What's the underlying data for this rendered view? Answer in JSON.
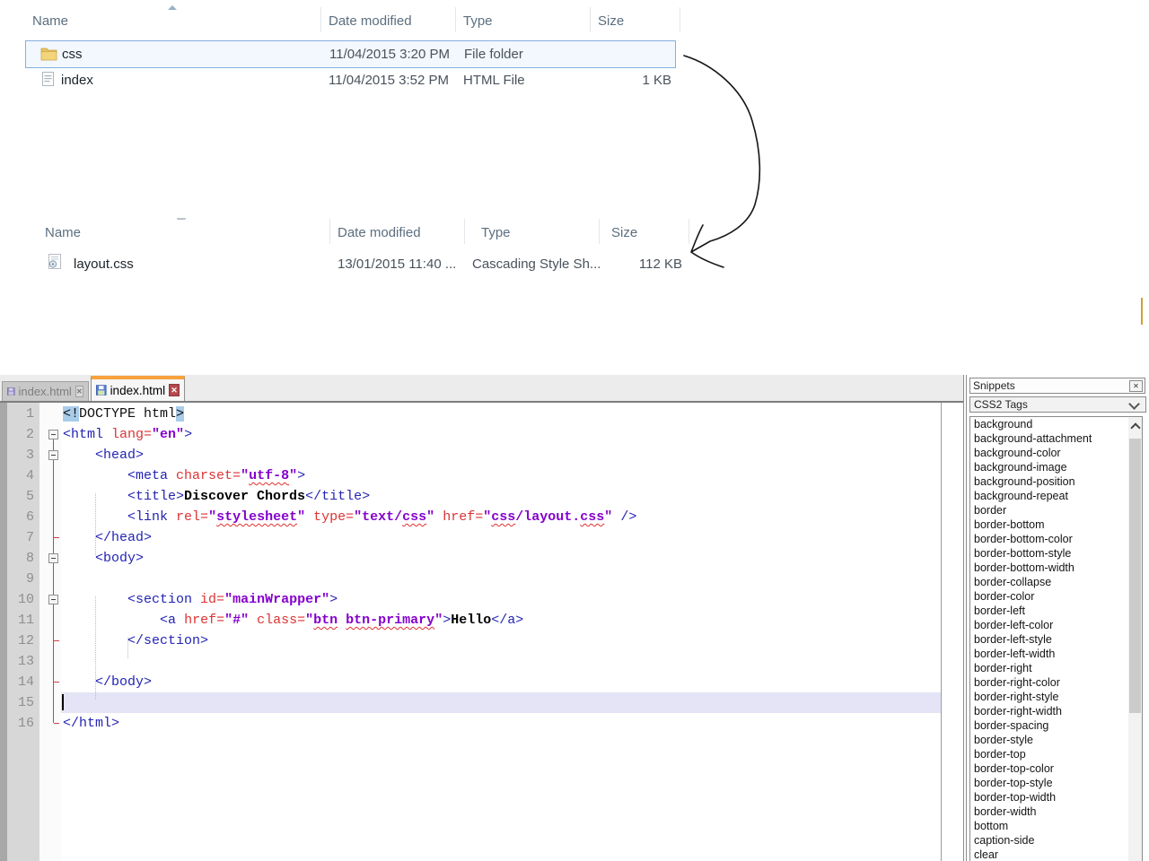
{
  "colors": {
    "accent_orange": "#f7a23c",
    "selection_blue_border": "#84b0e0",
    "fold_line_red": "#c94444",
    "tag_blue": "#2424b4",
    "attr_red": "#dc3434",
    "value_purple": "#8400cc",
    "current_line_bg": "#e4e4f6",
    "tag_match_highlight": "#a9cce9"
  },
  "explorer_top": {
    "columns": [
      "Name",
      "Date modified",
      "Type",
      "Size"
    ],
    "sort": "ascending",
    "rows": [
      {
        "name": "css",
        "date": "11/04/2015 3:20 PM",
        "type": "File folder",
        "size": "",
        "icon": "folder",
        "selected": true
      },
      {
        "name": "index",
        "date": "11/04/2015 3:52 PM",
        "type": "HTML File",
        "size": "1 KB",
        "icon": "html-file",
        "selected": false
      }
    ]
  },
  "explorer_bottom": {
    "columns": [
      "Name",
      "Date modified",
      "Type",
      "Size"
    ],
    "rows": [
      {
        "name": "layout.css",
        "date": "13/01/2015 11:40 ...",
        "type": "Cascading Style Sh...",
        "size": "112 KB",
        "icon": "css-file",
        "selected": false
      }
    ]
  },
  "editor": {
    "tabs": [
      {
        "label": "index.html",
        "active": false,
        "icon": "floppy-saved-icon",
        "close": "x"
      },
      {
        "label": "index.html",
        "active": true,
        "icon": "floppy-saved-icon",
        "close": "x"
      }
    ],
    "current_line": 15,
    "lines": [
      {
        "num": 1,
        "fold": null,
        "tokens": [
          [
            "hlm",
            "<!"
          ],
          [
            "pln",
            "DOCTYPE html"
          ],
          [
            "hlm",
            ">"
          ]
        ]
      },
      {
        "num": 2,
        "fold": "box",
        "tokens": [
          [
            "tag",
            "<html"
          ],
          [
            "pln",
            " "
          ],
          [
            "attr",
            "lang="
          ],
          [
            "val",
            "\"en\""
          ],
          [
            "tag",
            ">"
          ]
        ]
      },
      {
        "num": 3,
        "fold": "box",
        "tokens": [
          [
            "pln",
            "    "
          ],
          [
            "tag",
            "<head>"
          ]
        ]
      },
      {
        "num": 4,
        "fold": "line",
        "tokens": [
          [
            "pln",
            "        "
          ],
          [
            "tag",
            "<meta"
          ],
          [
            "pln",
            " "
          ],
          [
            "attr",
            "charset="
          ],
          [
            "val",
            "\""
          ],
          [
            "valw",
            "utf-8"
          ],
          [
            "val",
            "\""
          ],
          [
            "tag",
            ">"
          ]
        ]
      },
      {
        "num": 5,
        "fold": "line",
        "tokens": [
          [
            "pln",
            "        "
          ],
          [
            "tag",
            "<title>"
          ],
          [
            "txt",
            "Discover Chords"
          ],
          [
            "tag",
            "</title>"
          ]
        ]
      },
      {
        "num": 6,
        "fold": "line",
        "tokens": [
          [
            "pln",
            "        "
          ],
          [
            "tag",
            "<link"
          ],
          [
            "pln",
            " "
          ],
          [
            "attr",
            "rel="
          ],
          [
            "val",
            "\""
          ],
          [
            "valw",
            "stylesheet"
          ],
          [
            "val",
            "\""
          ],
          [
            "pln",
            " "
          ],
          [
            "attr",
            "type="
          ],
          [
            "val",
            "\"text/"
          ],
          [
            "valw",
            "css"
          ],
          [
            "val",
            "\""
          ],
          [
            "pln",
            " "
          ],
          [
            "attr",
            "href="
          ],
          [
            "val",
            "\""
          ],
          [
            "valw",
            "css"
          ],
          [
            "val",
            "/layout."
          ],
          [
            "valw",
            "css"
          ],
          [
            "val",
            "\""
          ],
          [
            "pln",
            " "
          ],
          [
            "tag",
            "/>"
          ]
        ]
      },
      {
        "num": 7,
        "fold": "tick",
        "tokens": [
          [
            "pln",
            "    "
          ],
          [
            "tag",
            "</head>"
          ]
        ]
      },
      {
        "num": 8,
        "fold": "box",
        "tokens": [
          [
            "pln",
            "    "
          ],
          [
            "tag",
            "<body>"
          ]
        ]
      },
      {
        "num": 9,
        "fold": "line",
        "tokens": []
      },
      {
        "num": 10,
        "fold": "box",
        "tokens": [
          [
            "pln",
            "        "
          ],
          [
            "tag",
            "<section"
          ],
          [
            "pln",
            " "
          ],
          [
            "attr",
            "id="
          ],
          [
            "val",
            "\"mainWrapper\""
          ],
          [
            "tag",
            ">"
          ]
        ]
      },
      {
        "num": 11,
        "fold": "line",
        "tokens": [
          [
            "pln",
            "            "
          ],
          [
            "tag",
            "<a"
          ],
          [
            "pln",
            " "
          ],
          [
            "attr",
            "href="
          ],
          [
            "val",
            "\"#\""
          ],
          [
            "pln",
            " "
          ],
          [
            "attr",
            "class="
          ],
          [
            "val",
            "\""
          ],
          [
            "valw",
            "btn"
          ],
          [
            "val",
            " "
          ],
          [
            "valw",
            "btn-primary"
          ],
          [
            "val",
            "\""
          ],
          [
            "tag",
            ">"
          ],
          [
            "txt",
            "Hello"
          ],
          [
            "tag",
            "</a>"
          ]
        ]
      },
      {
        "num": 12,
        "fold": "tick",
        "tokens": [
          [
            "pln",
            "        "
          ],
          [
            "tag",
            "</section>"
          ]
        ]
      },
      {
        "num": 13,
        "fold": "line",
        "tokens": []
      },
      {
        "num": 14,
        "fold": "tick",
        "tokens": [
          [
            "pln",
            "    "
          ],
          [
            "tag",
            "</body>"
          ]
        ]
      },
      {
        "num": 15,
        "fold": "line",
        "tokens": []
      },
      {
        "num": 16,
        "fold": "end",
        "tokens": [
          [
            "tag",
            "</html>"
          ]
        ]
      }
    ]
  },
  "snippets": {
    "title": "Snippets",
    "close_label": "x",
    "dropdown_value": "CSS2 Tags",
    "items": [
      "background",
      "background-attachment",
      "background-color",
      "background-image",
      "background-position",
      "background-repeat",
      "border",
      "border-bottom",
      "border-bottom-color",
      "border-bottom-style",
      "border-bottom-width",
      "border-collapse",
      "border-color",
      "border-left",
      "border-left-color",
      "border-left-style",
      "border-left-width",
      "border-right",
      "border-right-color",
      "border-right-style",
      "border-right-width",
      "border-spacing",
      "border-style",
      "border-top",
      "border-top-color",
      "border-top-style",
      "border-top-width",
      "border-width",
      "bottom",
      "caption-side",
      "clear"
    ]
  }
}
